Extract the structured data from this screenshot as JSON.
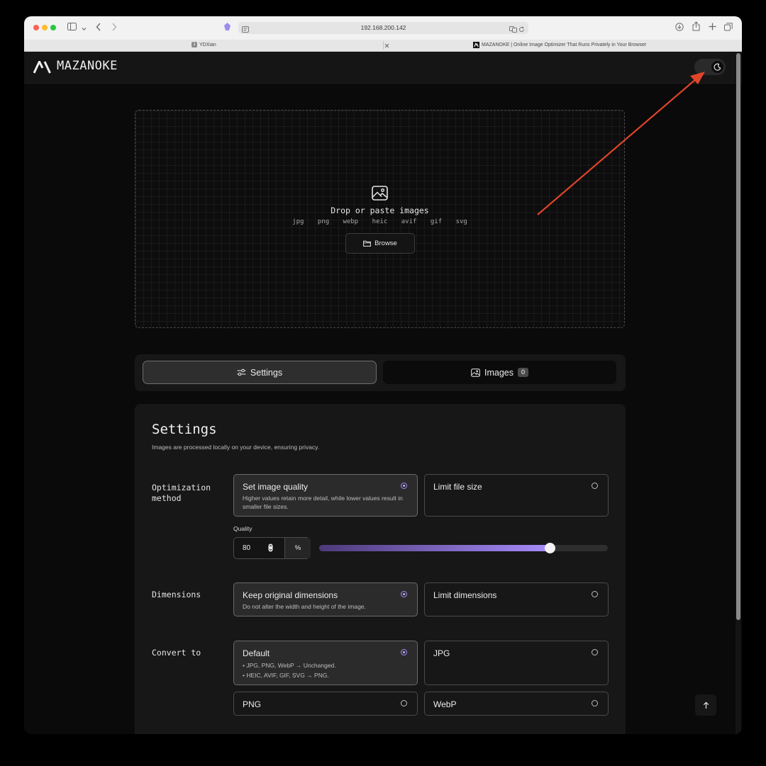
{
  "browser": {
    "address": "192.168.200.142",
    "tabs": [
      {
        "label": "YDXian",
        "favicon_text": "1"
      },
      {
        "label": "MAZANOKE | Online Image Optimizer That Runs Privately in Your Browser"
      }
    ],
    "icons": [
      "sidebar-icon",
      "chevron-down-icon",
      "back-icon",
      "forward-icon",
      "shield-icon",
      "reader-icon",
      "translate-icon",
      "reload-icon",
      "download-icon",
      "share-icon",
      "new-tab-icon",
      "tab-overview-icon",
      "tab-close-icon"
    ]
  },
  "header": {
    "brand": "MAZANOKE",
    "theme_toggle": "moon-icon"
  },
  "dropzone": {
    "title": "Drop or paste images",
    "formats": [
      "jpg",
      "png",
      "webp",
      "heic",
      "avif",
      "gif",
      "svg"
    ],
    "browse_label": "Browse"
  },
  "tabs": {
    "settings_label": "Settings",
    "images_label": "Images",
    "images_count": "0",
    "active": "Settings"
  },
  "settings": {
    "title": "Settings",
    "subtitle": "Images are processed locally on your device, ensuring privacy.",
    "optimization": {
      "label": "Optimization method",
      "options": [
        {
          "title": "Set image quality",
          "desc": "Higher values retain more detail, while lower values result in smaller file sizes.",
          "selected": true
        },
        {
          "title": "Limit file size",
          "desc": "",
          "selected": false
        }
      ],
      "quality_label": "Quality",
      "quality_value": "80",
      "quality_unit": "%",
      "quality_percent": 80
    },
    "dimensions": {
      "label": "Dimensions",
      "options": [
        {
          "title": "Keep original dimensions",
          "desc": "Do not alter the width and height of the image.",
          "selected": true
        },
        {
          "title": "Limit dimensions",
          "desc": "",
          "selected": false
        }
      ]
    },
    "convert": {
      "label": "Convert to",
      "options": [
        {
          "title": "Default",
          "desc_lines": [
            "• JPG, PNG, WebP → Unchanged.",
            "• HEIC, AVIF, GIF, SVG → PNG."
          ],
          "selected": true
        },
        {
          "title": "JPG",
          "selected": false
        },
        {
          "title": "PNG",
          "selected": false
        },
        {
          "title": "WebP",
          "selected": false
        }
      ]
    }
  },
  "colors": {
    "accent": "#a78bfa",
    "annotation_arrow": "#e0442a"
  }
}
